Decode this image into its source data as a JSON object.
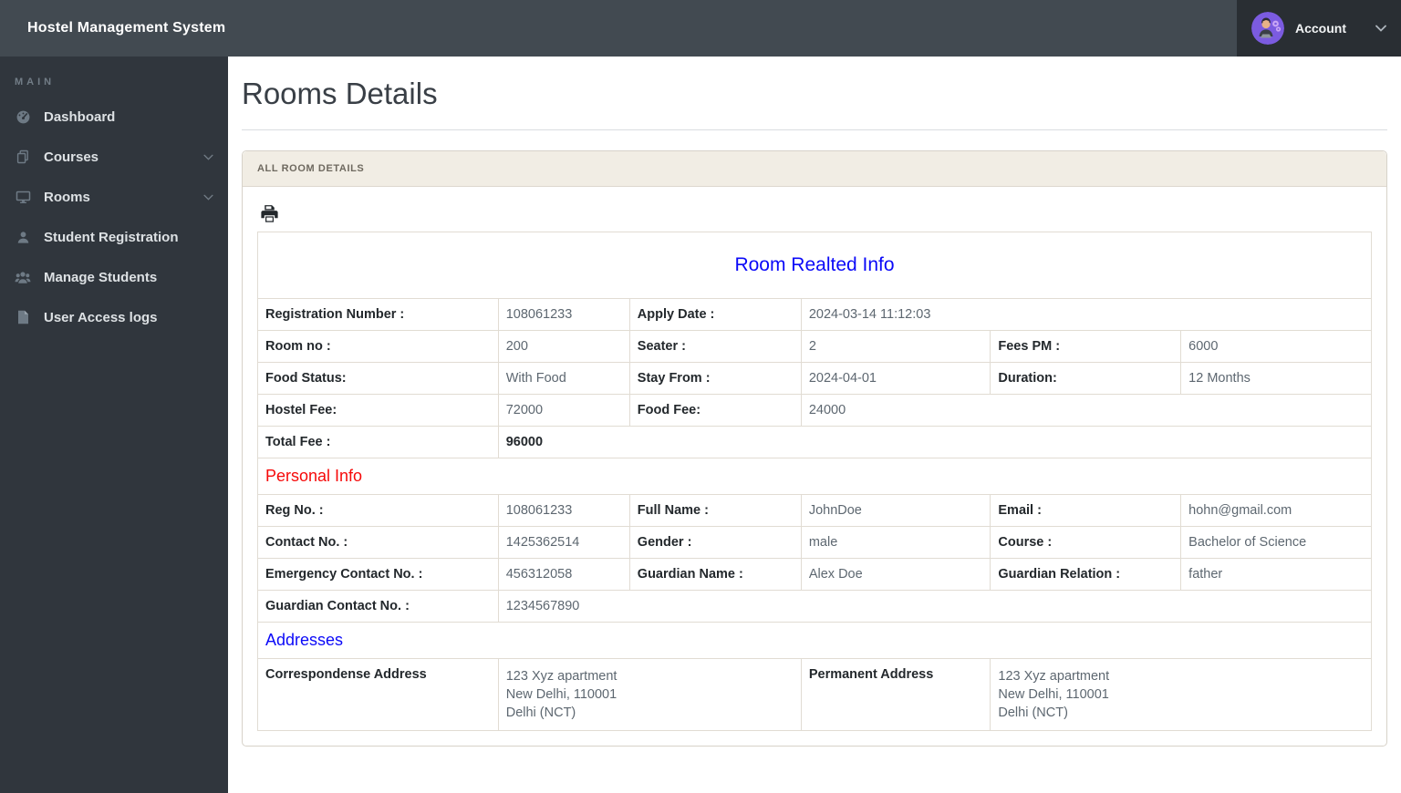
{
  "navbar": {
    "title": "Hostel Management System",
    "account_label": "Account"
  },
  "sidebar": {
    "section_label": "MAIN",
    "items": [
      {
        "label": "Dashboard",
        "icon": "speedometer-icon",
        "has_submenu": false
      },
      {
        "label": "Courses",
        "icon": "docs-icon",
        "has_submenu": true
      },
      {
        "label": "Rooms",
        "icon": "desktop-icon",
        "has_submenu": true
      },
      {
        "label": "Student Registration",
        "icon": "user-icon",
        "has_submenu": false
      },
      {
        "label": "Manage Students",
        "icon": "users-icon",
        "has_submenu": false
      },
      {
        "label": "User Access logs",
        "icon": "file-icon",
        "has_submenu": false
      }
    ]
  },
  "main": {
    "page_title": "Rooms Details",
    "panel_header": "ALL ROOM DETAILS",
    "print_icon": "printer-icon"
  },
  "colors": {
    "navbar_bg": "#424a51",
    "sidebar_bg": "#30363d",
    "account_bg": "#292e33",
    "avatar_purple": "#7b5be0",
    "panel_header_bg": "#f1ede4",
    "section_blue": "#0b09f8",
    "section_red": "#f60909"
  },
  "table": {
    "col_widths": [
      "21.6%",
      "11.8%",
      "15.4%",
      "17.0%",
      "17.1%",
      "17.1%"
    ],
    "rows": [
      {
        "type": "section",
        "text": "Room Realted Info",
        "color": "#0b09f8",
        "align": "center",
        "size": 21
      },
      {
        "type": "data",
        "cells": [
          {
            "kind": "label",
            "text": "Registration Number :"
          },
          {
            "kind": "value",
            "text": "108061233"
          },
          {
            "kind": "label",
            "text": "Apply Date :"
          },
          {
            "kind": "value",
            "text": "2024-03-14 11:12:03",
            "colspan": 3
          }
        ]
      },
      {
        "type": "data",
        "cells": [
          {
            "kind": "label",
            "text": "Room no :"
          },
          {
            "kind": "value",
            "text": "200"
          },
          {
            "kind": "label",
            "text": "Seater :"
          },
          {
            "kind": "value",
            "text": "2"
          },
          {
            "kind": "label",
            "text": "Fees PM :"
          },
          {
            "kind": "value",
            "text": "6000"
          }
        ]
      },
      {
        "type": "data",
        "cells": [
          {
            "kind": "label",
            "text": "Food Status:"
          },
          {
            "kind": "value",
            "text": "With Food"
          },
          {
            "kind": "label",
            "text": "Stay From :"
          },
          {
            "kind": "value",
            "text": "2024-04-01"
          },
          {
            "kind": "label",
            "text": "Duration:"
          },
          {
            "kind": "value",
            "text": "12 Months"
          }
        ]
      },
      {
        "type": "data",
        "cells": [
          {
            "kind": "label",
            "text": "Hostel Fee:"
          },
          {
            "kind": "value",
            "text": "72000"
          },
          {
            "kind": "label",
            "text": "Food Fee:"
          },
          {
            "kind": "value",
            "text": "24000",
            "colspan": 3
          }
        ]
      },
      {
        "type": "data",
        "cells": [
          {
            "kind": "label",
            "text": "Total Fee :"
          },
          {
            "kind": "value",
            "text": "96000",
            "colspan": 5,
            "bold": true
          }
        ]
      },
      {
        "type": "section",
        "text": "Personal Info",
        "color": "#f60909",
        "align": "left",
        "size": 18
      },
      {
        "type": "data",
        "cells": [
          {
            "kind": "label",
            "text": "Reg No. :"
          },
          {
            "kind": "value",
            "text": "108061233"
          },
          {
            "kind": "label",
            "text": "Full Name :"
          },
          {
            "kind": "value",
            "text": "JohnDoe"
          },
          {
            "kind": "label",
            "text": "Email :"
          },
          {
            "kind": "value",
            "text": "hohn@gmail.com"
          }
        ]
      },
      {
        "type": "data",
        "cells": [
          {
            "kind": "label",
            "text": "Contact No. :"
          },
          {
            "kind": "value",
            "text": "1425362514"
          },
          {
            "kind": "label",
            "text": "Gender :"
          },
          {
            "kind": "value",
            "text": "male"
          },
          {
            "kind": "label",
            "text": "Course :"
          },
          {
            "kind": "value",
            "text": "Bachelor of Science"
          }
        ]
      },
      {
        "type": "data",
        "cells": [
          {
            "kind": "label",
            "text": "Emergency Contact No. :"
          },
          {
            "kind": "value",
            "text": "456312058"
          },
          {
            "kind": "label",
            "text": "Guardian Name :"
          },
          {
            "kind": "value",
            "text": "Alex Doe"
          },
          {
            "kind": "label",
            "text": "Guardian Relation :"
          },
          {
            "kind": "value",
            "text": "father"
          }
        ]
      },
      {
        "type": "data",
        "cells": [
          {
            "kind": "label",
            "text": "Guardian Contact No. :"
          },
          {
            "kind": "value",
            "text": "1234567890",
            "colspan": 5
          }
        ]
      },
      {
        "type": "section",
        "text": "Addresses",
        "color": "#0b09f8",
        "align": "left",
        "size": 18
      },
      {
        "type": "data",
        "cells": [
          {
            "kind": "label",
            "text": "Correspondense Address"
          },
          {
            "kind": "value",
            "lines": [
              "123 Xyz apartment",
              "New Delhi, 110001",
              "Delhi (NCT)"
            ],
            "colspan": 2
          },
          {
            "kind": "label",
            "text": "Permanent Address"
          },
          {
            "kind": "value",
            "lines": [
              "123 Xyz apartment",
              "New Delhi, 110001",
              "Delhi (NCT)"
            ],
            "colspan": 2
          }
        ]
      }
    ]
  }
}
